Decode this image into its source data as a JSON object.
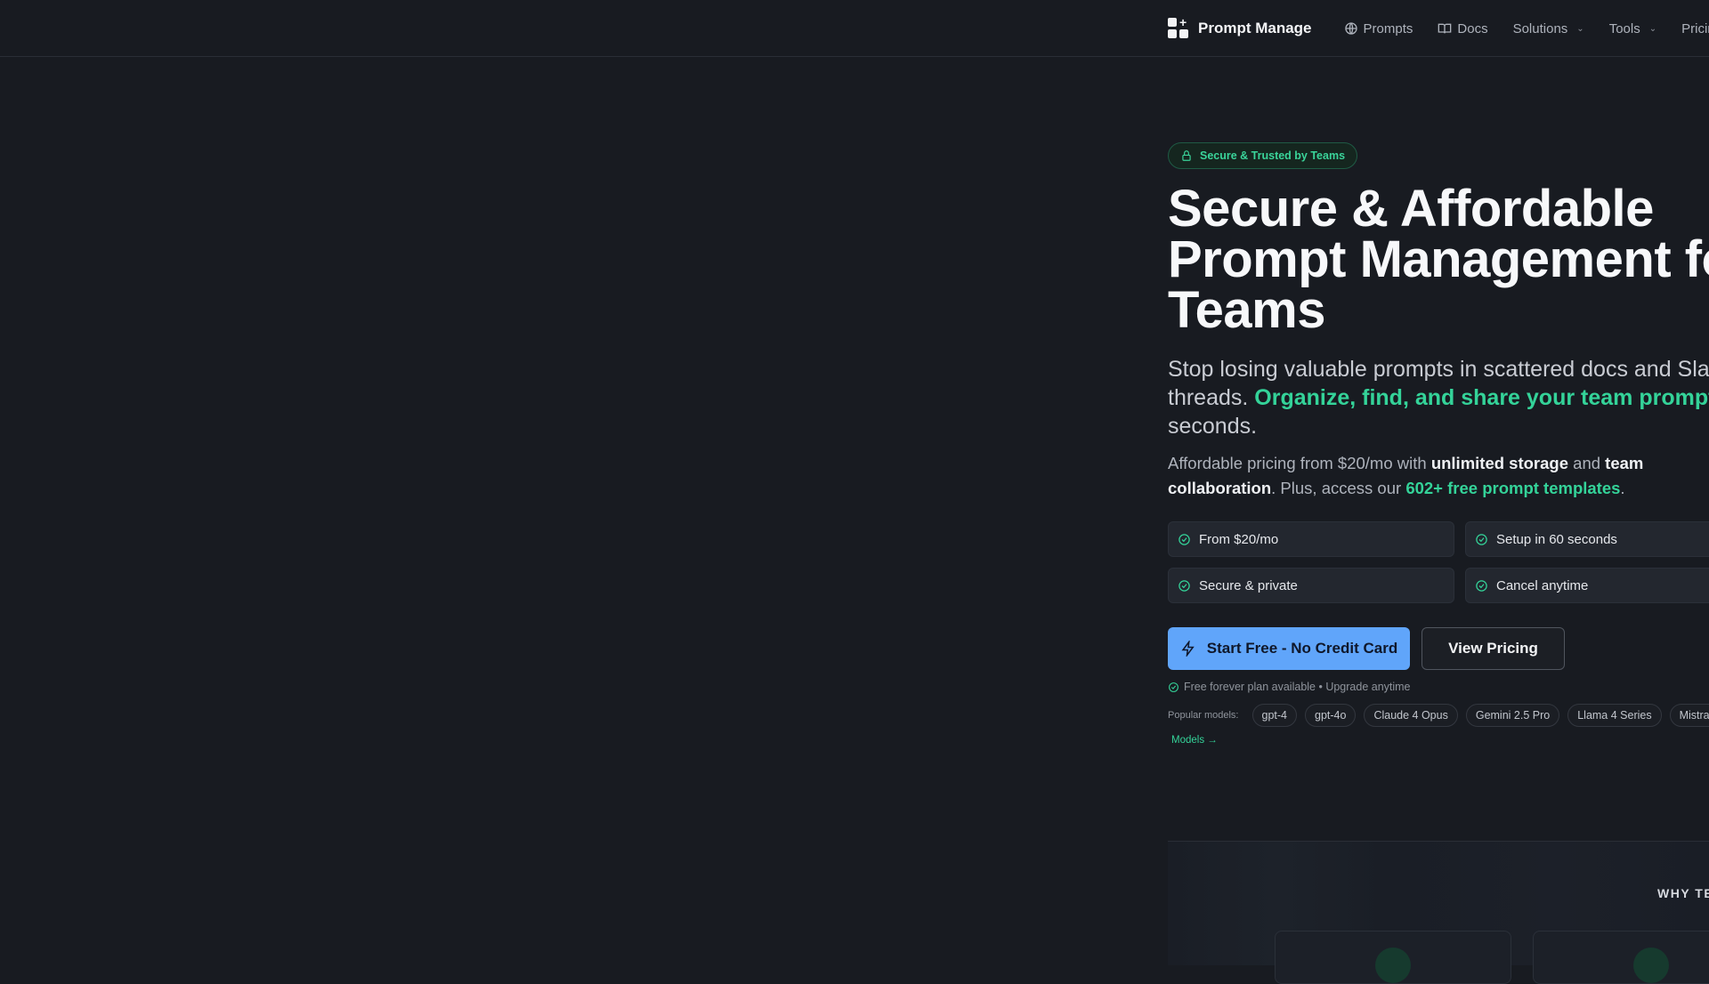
{
  "nav": {
    "brand": "Prompt Manage",
    "items": [
      {
        "label": "Prompts",
        "icon": "globe-icon"
      },
      {
        "label": "Docs",
        "icon": "book-icon"
      },
      {
        "label": "Solutions",
        "dropdown": true
      },
      {
        "label": "Tools",
        "dropdown": true
      },
      {
        "label": "Pricing"
      }
    ]
  },
  "hero": {
    "badge": "Secure & Trusted by Teams",
    "headline_line1": "Secure & Affordable",
    "headline_line2": "Prompt Management for",
    "headline_line3": "Teams",
    "sub1_a": "Stop losing valuable prompts in scattered docs and Slack",
    "sub1_b": "threads. ",
    "sub1_highlight": "Organize, find, and share your team prompts in",
    "sub1_c": "seconds.",
    "sub2_a": "Affordable pricing from $20/mo with ",
    "sub2_b1": "unlimited storage",
    "sub2_c": " and ",
    "sub2_b2": "team",
    "sub2_b3": "collaboration",
    "sub2_d": ". Plus, access our ",
    "sub2_link": "602+ free prompt templates",
    "sub2_e": ".",
    "features": [
      "From $20/mo",
      "Setup in 60 seconds",
      "Secure & private",
      "Cancel anytime"
    ],
    "cta_primary": "Start Free - No Credit Card",
    "cta_secondary": "View Pricing",
    "note": "Free forever plan available • Upgrade anytime",
    "models_label": "Popular models:",
    "models": [
      "gpt-4",
      "gpt-4o",
      "Claude 4 Opus",
      "Gemini 2.5 Pro",
      "Llama 4 Series",
      "Mistral Large"
    ],
    "models_link": "Models →"
  },
  "why": {
    "label": "WHY TEAMS"
  },
  "colors": {
    "background": "#181b21",
    "accent_green": "#34d399",
    "primary_button": "#60a5fa"
  }
}
